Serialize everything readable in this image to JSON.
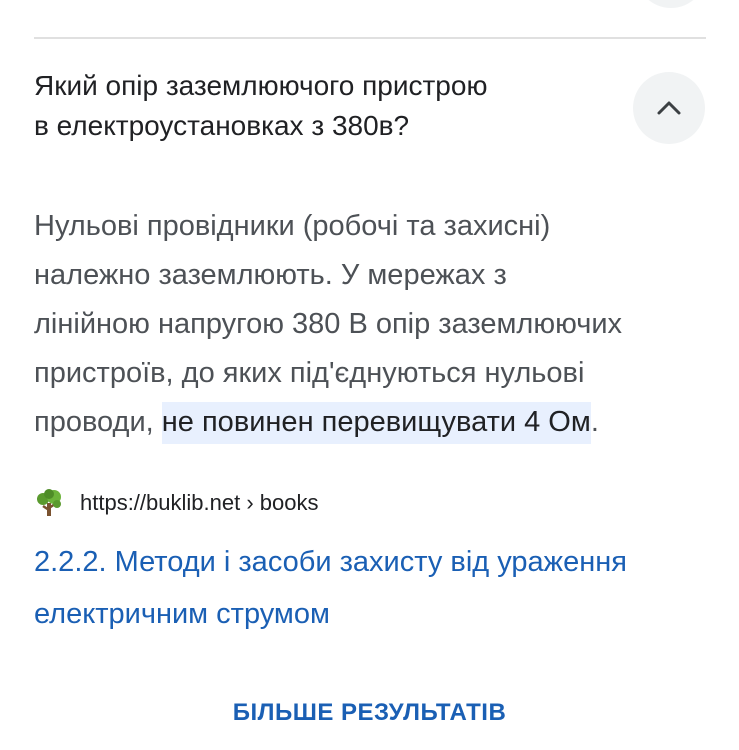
{
  "faq_item": {
    "question_lines": [
      "Який опір заземлюючого пристрою",
      "в електроустановках з 380в?"
    ],
    "answer": {
      "line1": "Нульові провідники (робочі та захисні)",
      "line2": "належно заземлюють. У мережах з",
      "line3": "лінійною напругою 380 В опір заземлюючих",
      "line4": "пристроїв, до яких під'єднуються нульові",
      "line5_prefix": "проводи, ",
      "line5_highlight": "не повинен перевищувати 4 Ом",
      "line5_suffix": "."
    },
    "toggle_icon": "chevron-up-icon",
    "source": {
      "favicon": "tree-icon",
      "url_text": "https://buklib.net › books",
      "title_lines": [
        "2.2.2. Методи і засоби захисту від ураження",
        "електричним струмом"
      ]
    }
  },
  "more_results_label": "БІЛЬШЕ РЕЗУЛЬТАТІВ",
  "colors": {
    "link": "#1a5fb4",
    "highlight_bg": "#e8f0fe",
    "button_bg": "#f1f3f4",
    "divider": "#e0e0e0"
  }
}
